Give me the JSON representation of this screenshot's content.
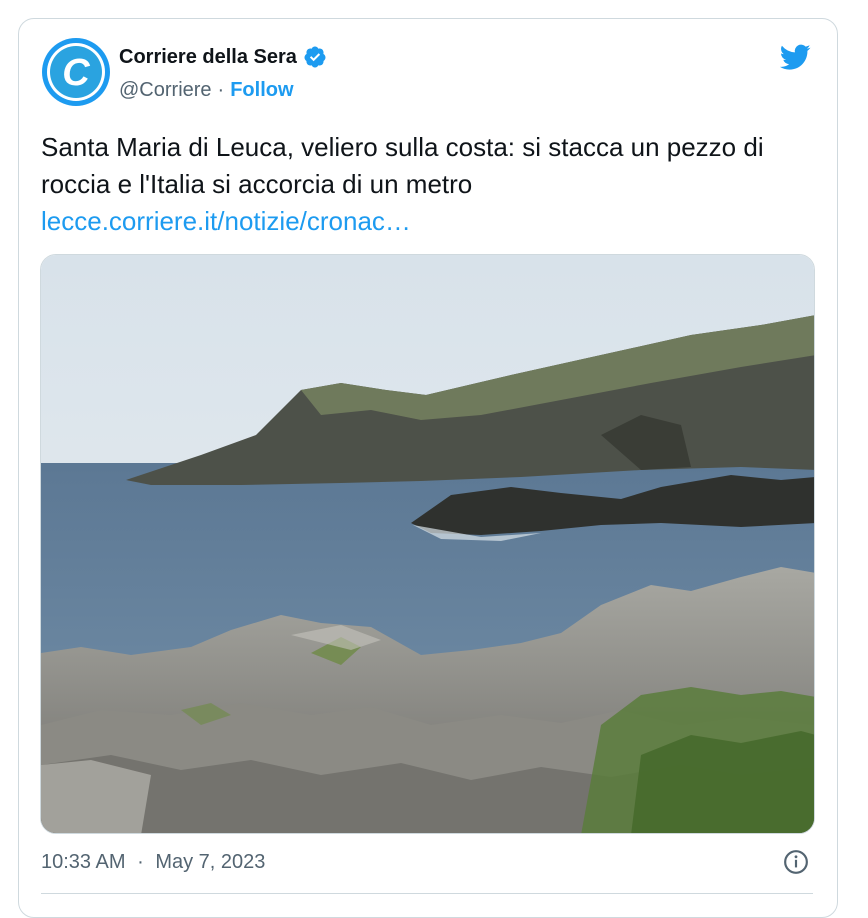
{
  "author": {
    "name": "Corriere della Sera",
    "handle": "@Corriere",
    "separator": "·",
    "follow_label": "Follow",
    "avatar_letter": "C"
  },
  "tweet": {
    "text": "Santa Maria di Leuca, veliero sulla costa: si stacca un pezzo di roccia e l'Italia si accorcia di un metro",
    "link": "lecce.corriere.it/notizie/cronac…"
  },
  "meta": {
    "time": "10:33 AM",
    "separator": "·",
    "date": "May 7, 2023"
  },
  "icons": {
    "brand": "twitter-bird-icon",
    "verified": "verified-badge-icon",
    "info": "info-icon"
  },
  "colors": {
    "accent": "#1d9bf0",
    "text": "#0f1419",
    "muted": "#536471",
    "border": "#cfd9de"
  }
}
